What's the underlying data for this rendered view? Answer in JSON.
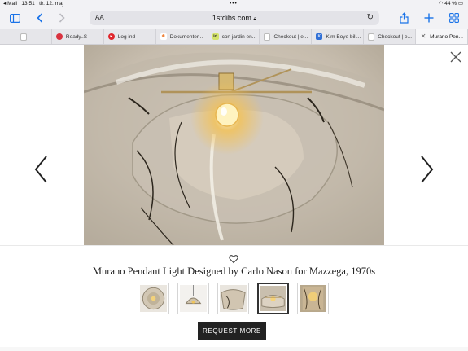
{
  "status_bar": {
    "back_app": "◂ Mail",
    "time": "13.51",
    "date": "tir. 12. maj",
    "battery": "44 %"
  },
  "toolbar": {
    "reader_label": "AA",
    "url": "1stdibs.com",
    "accent_color": "#1a73e8"
  },
  "tabs": [
    {
      "label": "Ready..S",
      "icon": "red-circle-icon",
      "color": "#d9323f"
    },
    {
      "label": "Log ind",
      "icon": "play-icon",
      "color": "#e0262c"
    },
    {
      "label": "Dokumenter...",
      "icon": "spark-icon",
      "color": "#ef7d33"
    },
    {
      "label": "con jardin en...",
      "icon": "id-icon",
      "color": "#a8c83a"
    },
    {
      "label": "Checkout | e...",
      "icon": "page-icon",
      "color": "#999999"
    },
    {
      "label": "Kim Boye bill...",
      "icon": "k-icon",
      "color": "#2f6fd6"
    },
    {
      "label": "Checkout | e...",
      "icon": "page-icon",
      "color": "#999999"
    },
    {
      "label": "Murano Pen...",
      "icon": "close-icon",
      "color": "#666666",
      "active": true
    }
  ],
  "product": {
    "title": "Murano Pendant Light Designed by Carlo Nason for Mazzega, 1970s",
    "button_label": "REQUEST MORE",
    "selected_thumbnail": 4,
    "thumbnail_count": 5
  }
}
